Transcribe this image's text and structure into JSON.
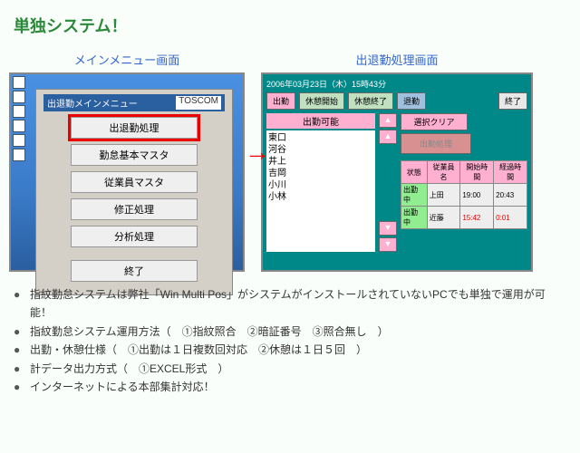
{
  "page_title": "単独システム！",
  "left": {
    "label": "メインメニュー画面",
    "panel_title": "出退勤メインメニュー",
    "brand": "TOSCOM",
    "buttons": [
      "出退勤処理",
      "勤怠基本マスタ",
      "従業員マスタ",
      "修正処理",
      "分析処理"
    ],
    "exit": "終了"
  },
  "right": {
    "label": "出退勤処理画面",
    "timestamp": "2006年03月23日（木）15時43分",
    "top_buttons": {
      "b1": "出勤",
      "b2": "休憩開始",
      "b3": "休憩終了",
      "b4": "退勤",
      "exit": "終了"
    },
    "list_label": "出勤可能",
    "names": [
      "東口",
      "河谷",
      "井上",
      "吉岡",
      "小川",
      "小林"
    ],
    "clear": "選択クリア",
    "proc": "出勤処理",
    "table": {
      "headers": [
        "状態",
        "従業員名",
        "開始時間",
        "経過時間"
      ],
      "rows": [
        [
          "出勤中",
          "上田",
          "19:00",
          "20:43"
        ],
        [
          "出勤中",
          "近藤",
          "15:42",
          "0:01"
        ]
      ]
    }
  },
  "bullets": [
    "指紋勤怠システムは弊社「Win Multi Pos」がシステムがインストールされていないPCでも単独で運用が可能！",
    "指紋勤怠システム運用方法（　①指紋照合　②暗証番号　③照合無し　）",
    "出勤・休憩仕様（　①出勤は１日複数回対応　②休憩は１日５回　）",
    "計データ出力方式（　①EXCEL形式　）",
    "インターネットによる本部集計対応！"
  ]
}
